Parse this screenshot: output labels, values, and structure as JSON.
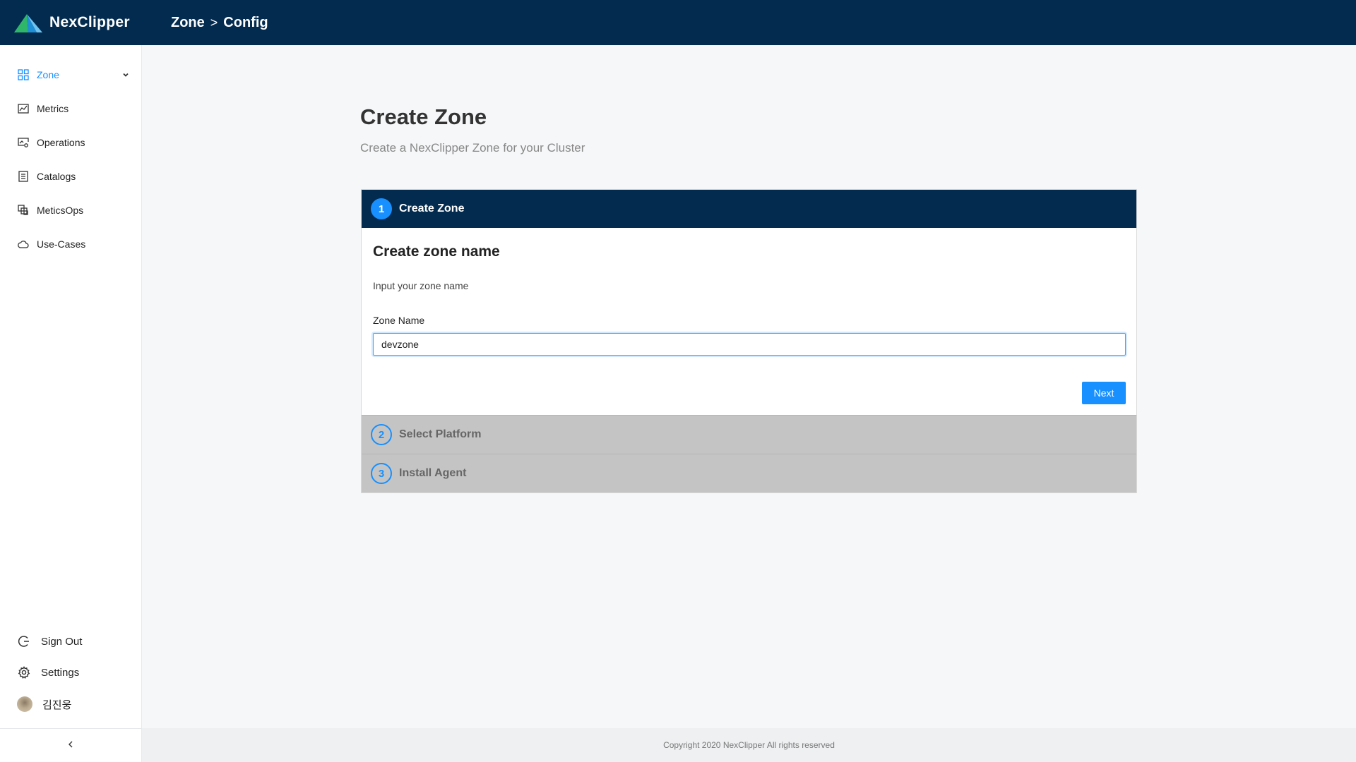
{
  "header": {
    "logo_text": "NexClipper",
    "breadcrumb": [
      "Zone",
      "Config"
    ],
    "breadcrumb_separator": ">"
  },
  "sidebar": {
    "items": [
      {
        "label": "Zone",
        "icon": "grid-icon",
        "active": true
      },
      {
        "label": "Metrics",
        "icon": "line-chart-icon"
      },
      {
        "label": "Operations",
        "icon": "monitor-gear-icon"
      },
      {
        "label": "Catalogs",
        "icon": "list-doc-icon"
      },
      {
        "label": "MeticsOps",
        "icon": "stacked-squares-icon"
      },
      {
        "label": "Use-Cases",
        "icon": "cloud-icon"
      }
    ],
    "bottom": {
      "sign_out": "Sign Out",
      "settings": "Settings",
      "user_name": "김진웅"
    }
  },
  "page": {
    "title": "Create Zone",
    "subtitle": "Create a NexClipper Zone for your Cluster"
  },
  "wizard": {
    "steps": [
      {
        "number": "1",
        "label": "Create Zone"
      },
      {
        "number": "2",
        "label": "Select Platform"
      },
      {
        "number": "3",
        "label": "Install Agent"
      }
    ],
    "body_title": "Create zone name",
    "body_desc": "Input your zone name",
    "field_label": "Zone Name",
    "field_value": "devzone",
    "next_label": "Next"
  },
  "footer": {
    "copyright": "Copyright 2020 NexClipper All rights reserved"
  },
  "colors": {
    "header_bg": "#032b4f",
    "accent": "#1890ff",
    "inactive_step_bg": "#c4c4c4"
  }
}
